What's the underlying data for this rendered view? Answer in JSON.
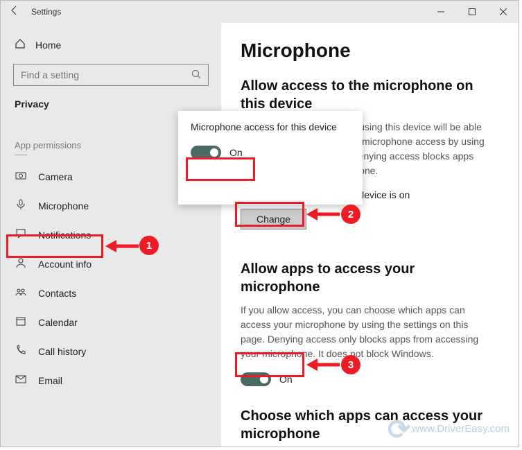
{
  "titlebar": {
    "title": "Settings"
  },
  "sidebar": {
    "home_label": "Home",
    "search_placeholder": "Find a setting",
    "category_header": "Privacy",
    "section_label": "App permissions",
    "items": [
      {
        "label": "Camera"
      },
      {
        "label": "Microphone"
      },
      {
        "label": "Notifications"
      },
      {
        "label": "Account info"
      },
      {
        "label": "Contacts"
      },
      {
        "label": "Calendar"
      },
      {
        "label": "Call history"
      },
      {
        "label": "Email"
      }
    ]
  },
  "content": {
    "page_title": "Microphone",
    "sect1": {
      "heading": "Allow access to the microphone on this device",
      "desc": "If you allow access, people using this device will be able to choose if their apps have microphone access by using the settings on this page. Denying access blocks apps from accessing the microphone.",
      "status": "Microphone access for this device is on",
      "change_btn": "Change"
    },
    "sect2": {
      "heading": "Allow apps to access your microphone",
      "desc": "If you allow access, you can choose which apps can access your microphone by using the settings on this page. Denying access only blocks apps from accessing your microphone. It does not block Windows.",
      "toggle_label": "On"
    },
    "sect3": {
      "heading": "Choose which apps can access your microphone"
    }
  },
  "popup": {
    "title": "Microphone access for this device",
    "toggle_label": "On"
  },
  "annotations": {
    "n1": "1",
    "n2": "2",
    "n3": "3"
  },
  "watermark": {
    "text": "www.DriverEasy.com"
  }
}
